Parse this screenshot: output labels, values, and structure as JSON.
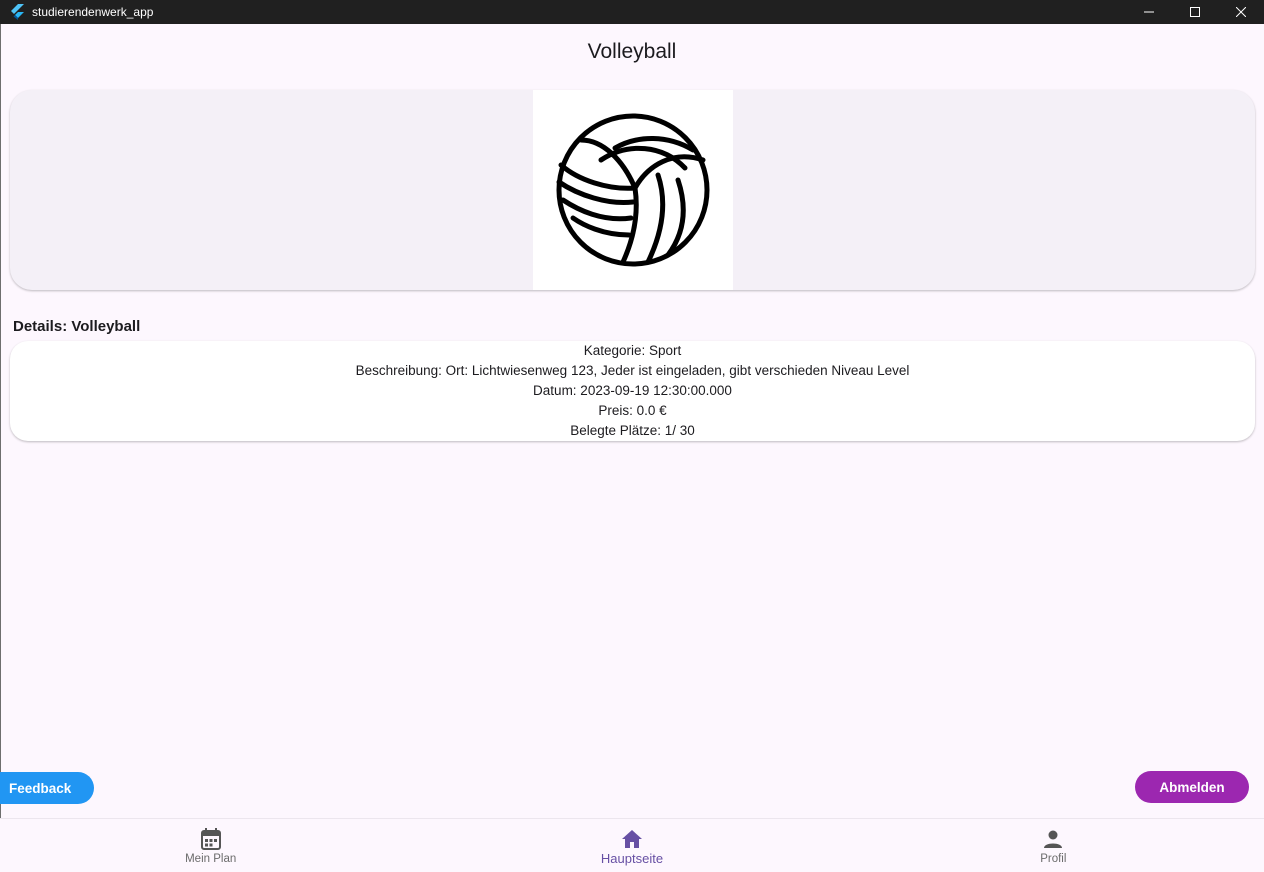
{
  "window": {
    "title": "studierendenwerk_app"
  },
  "page": {
    "title": "Volleyball"
  },
  "image": {
    "icon": "volleyball-icon"
  },
  "details": {
    "heading": "Details: Volleyball",
    "kategorie": "Kategorie: Sport",
    "beschreibung": "Beschreibung: Ort: Lichtwiesenweg 123, Jeder ist eingeladen, gibt verschieden Niveau Level",
    "datum": "Datum: 2023-09-19 12:30:00.000",
    "preis": "Preis: 0.0 €",
    "plaetze": "Belegte Plätze: 1/ 30"
  },
  "buttons": {
    "feedback": "Feedback",
    "abmelden": "Abmelden"
  },
  "nav": {
    "items": [
      {
        "label": "Mein Plan",
        "icon": "calendar-icon",
        "active": false
      },
      {
        "label": "Hauptseite",
        "icon": "home-icon",
        "active": true
      },
      {
        "label": "Profil",
        "icon": "person-icon",
        "active": false
      }
    ]
  },
  "colors": {
    "accent": "#6750a4",
    "feedback": "#2196f3",
    "abmelden": "#9c27b0",
    "background": "#fdf7fe"
  }
}
